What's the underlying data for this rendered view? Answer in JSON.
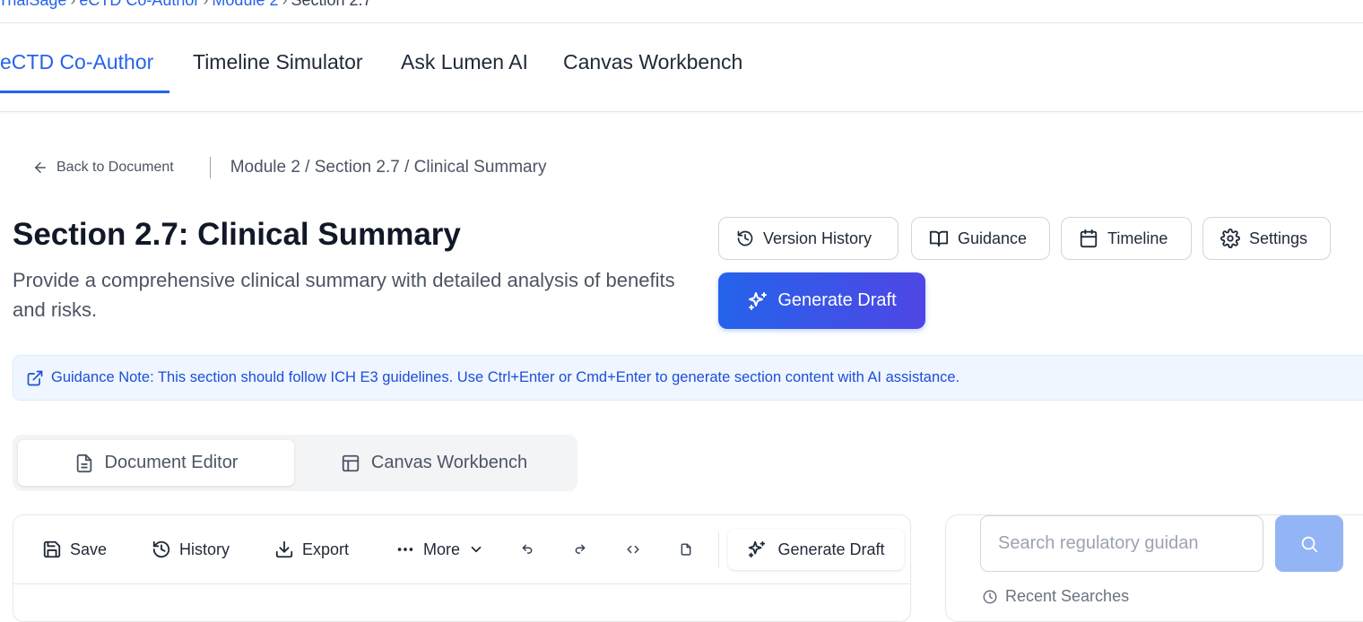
{
  "breadcrumb": {
    "items": [
      "TrialSage",
      "eCTD Co-Author",
      "Module 2",
      "Section 2.7"
    ],
    "separator": "›"
  },
  "main_tabs": [
    {
      "label": "eCTD Co-Author",
      "active": true
    },
    {
      "label": "Timeline Simulator",
      "active": false
    },
    {
      "label": "Ask Lumen AI",
      "active": false
    },
    {
      "label": "Canvas Workbench",
      "active": false
    }
  ],
  "nav": {
    "back_label": "Back to Document",
    "path": "Module 2 / Section 2.7 / Clinical Summary"
  },
  "page": {
    "title": "Section 2.7: Clinical Summary",
    "subtitle": "Provide a comprehensive clinical summary with detailed analysis of benefits and risks."
  },
  "header_actions": {
    "version_history": "Version History",
    "guidance": "Guidance",
    "timeline": "Timeline",
    "settings": "Settings",
    "generate_draft": "Generate Draft"
  },
  "guidance_note": "Guidance Note: This section should follow ICH E3 guidelines. Use Ctrl+Enter or Cmd+Enter to generate section content with AI assistance.",
  "editor_tabs": [
    {
      "label": "Document Editor",
      "active": true,
      "icon": "file-text-icon"
    },
    {
      "label": "Canvas Workbench",
      "active": false,
      "icon": "layout-icon"
    }
  ],
  "toolbar": {
    "save": "Save",
    "history": "History",
    "export": "Export",
    "more": "More",
    "generate_draft": "Generate Draft"
  },
  "search": {
    "placeholder": "Search regulatory guidan",
    "recent_label": "Recent Searches"
  },
  "colors": {
    "accent": "#2563eb",
    "accent_gradient_end": "#4f46e5",
    "guidance_bg": "#eff6ff",
    "search_button": "#93b4f5"
  }
}
